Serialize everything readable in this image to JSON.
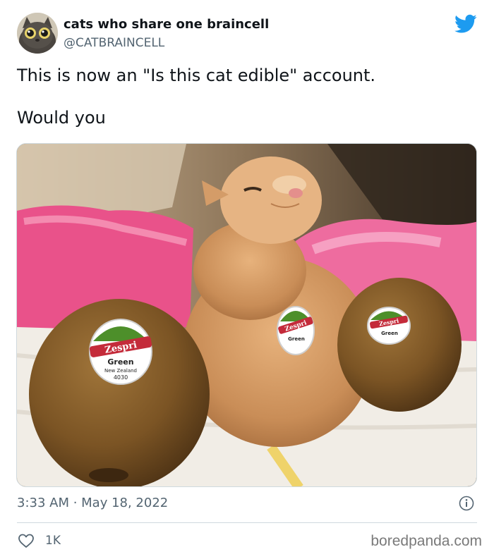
{
  "author": {
    "display_name": "cats who share one braincell",
    "handle": "@CATBRAINCELL",
    "avatar_icon": "cat-avatar"
  },
  "tweet": {
    "text_line_1": "This is now an \"Is this cat edible\" account.",
    "text_line_2": "Would you",
    "timestamp": "3:33 AM · May 18, 2022",
    "like_count": "1K"
  },
  "photo": {
    "sticker_brand": "Zespri",
    "sticker_variety": "Green",
    "sticker_origin": "New Zealand",
    "sticker_code": "4030"
  },
  "icons": {
    "platform": "twitter-bird-icon",
    "info": "info-icon",
    "like": "heart-icon"
  },
  "colors": {
    "twitter_blue": "#1d9bf0",
    "text_primary": "#0f1419",
    "text_secondary": "#536471"
  },
  "watermark": "boredpanda.com"
}
